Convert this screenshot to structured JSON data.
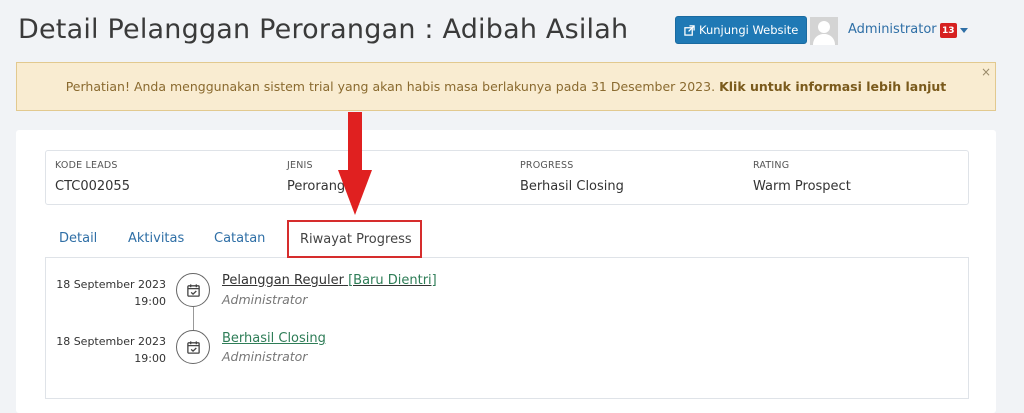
{
  "header": {
    "title": "Detail Pelanggan Perorangan : Adibah Asilah",
    "website_button": "Kunjungi Website",
    "user_name": "Administrator",
    "notif_count": "13"
  },
  "alert": {
    "message": "Perhatian! Anda menggunakan sistem trial yang akan habis masa berlakunya pada 31 Desember 2023.",
    "link": "Klik untuk informasi lebih lanjut",
    "close": "×"
  },
  "info": [
    {
      "label": "KODE LEADS",
      "value": "CTC002055"
    },
    {
      "label": "JENIS",
      "value": "Perorang"
    },
    {
      "label": "PROGRESS",
      "value": "Berhasil Closing"
    },
    {
      "label": "RATING",
      "value": "Warm Prospect"
    }
  ],
  "tabs": [
    {
      "label": "Detail"
    },
    {
      "label": "Aktivitas"
    },
    {
      "label": "Catatan"
    },
    {
      "label": "Riwayat Progress",
      "active": true
    }
  ],
  "timeline": [
    {
      "date": "18 September 2023",
      "time": "19:00",
      "title": "Pelanggan Reguler",
      "tag": "[Baru Dientri]",
      "by": "Administrator"
    },
    {
      "date": "18 September 2023",
      "time": "19:00",
      "title": "Berhasil Closing",
      "tag": "",
      "by": "Administrator"
    }
  ],
  "colors": {
    "primary": "#1f79b5",
    "alert_bg": "#f9ecd1",
    "highlight": "#d62d2d",
    "link_green": "#2e7d57"
  }
}
